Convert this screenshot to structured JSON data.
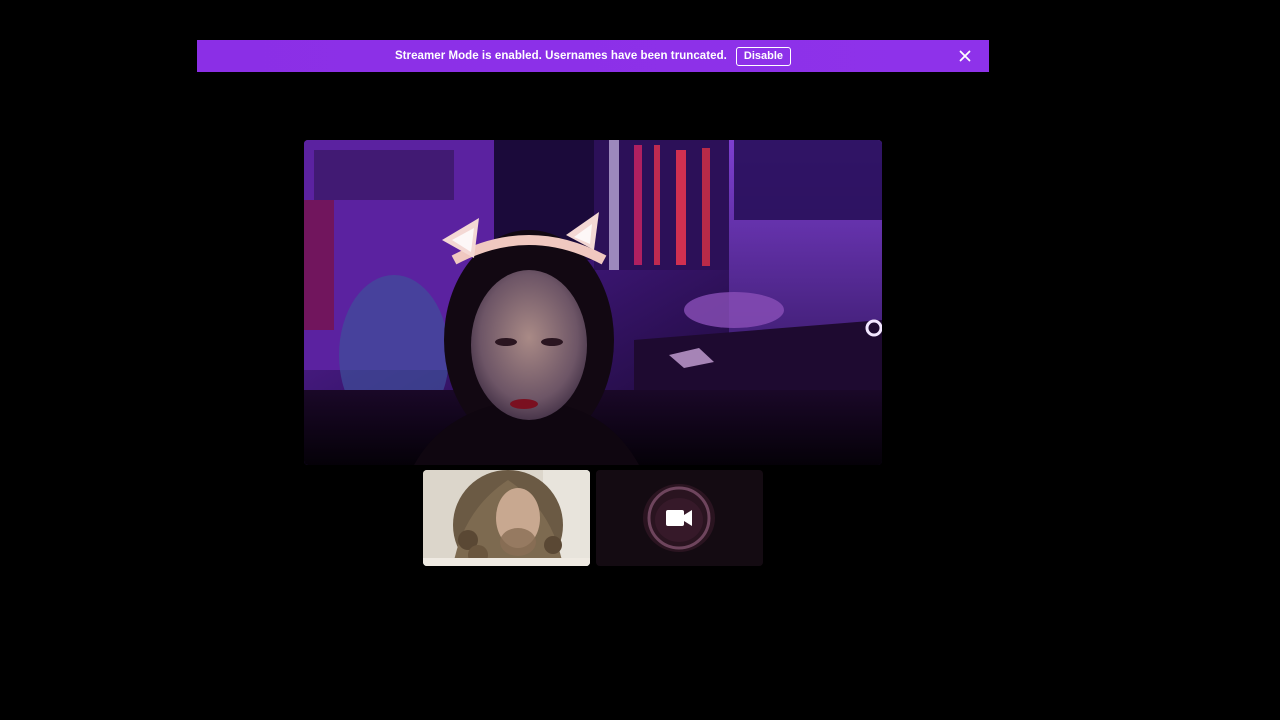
{
  "banner": {
    "message": "Streamer Mode is enabled. Usernames have been truncated.",
    "disable_label": "Disable",
    "close_icon": "close-icon",
    "background_color": "#8b2fe6"
  },
  "main_video": {
    "icon": "participant-video"
  },
  "thumbnails": [
    {
      "icon": "participant-video"
    },
    {
      "icon": "camera-icon"
    }
  ]
}
